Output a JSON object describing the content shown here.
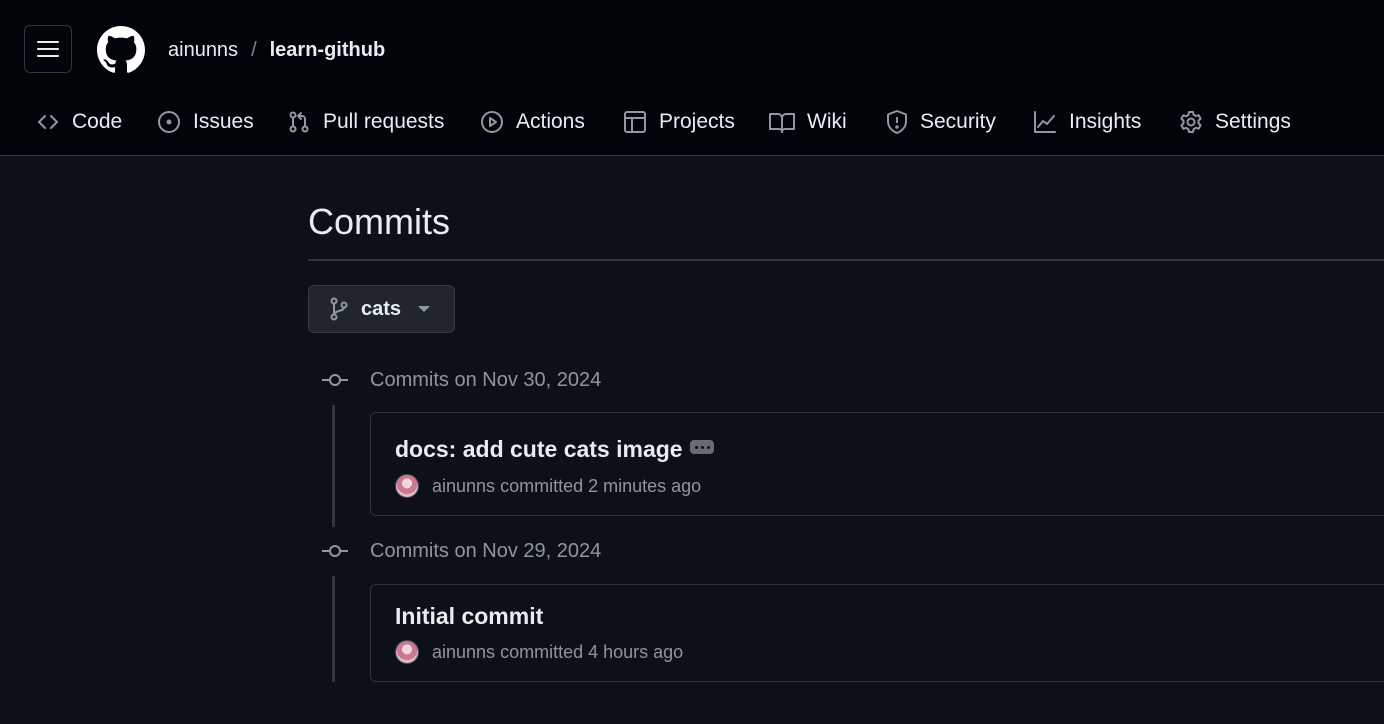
{
  "header": {
    "owner": "ainunns",
    "separator": "/",
    "repo": "learn-github"
  },
  "tabs": [
    {
      "label": "Code",
      "icon": "code-icon"
    },
    {
      "label": "Issues",
      "icon": "issue-opened-icon"
    },
    {
      "label": "Pull requests",
      "icon": "git-pull-request-icon"
    },
    {
      "label": "Actions",
      "icon": "play-icon"
    },
    {
      "label": "Projects",
      "icon": "table-icon"
    },
    {
      "label": "Wiki",
      "icon": "book-icon"
    },
    {
      "label": "Security",
      "icon": "shield-icon"
    },
    {
      "label": "Insights",
      "icon": "graph-icon"
    },
    {
      "label": "Settings",
      "icon": "gear-icon"
    }
  ],
  "page": {
    "title": "Commits",
    "branch": "cats"
  },
  "commit_groups": [
    {
      "date_label": "Commits on Nov 30, 2024",
      "commits": [
        {
          "message": "docs: add cute cats image",
          "author": "ainunns",
          "action": "committed",
          "time": "2 minutes ago"
        }
      ]
    },
    {
      "date_label": "Commits on Nov 29, 2024",
      "commits": [
        {
          "message": "Initial commit",
          "author": "ainunns",
          "action": "committed",
          "time": "4 hours ago"
        }
      ]
    }
  ],
  "colors": {
    "background": "#0d1117",
    "header_background": "#010409",
    "border": "#30363d",
    "muted_text": "#8d96a0",
    "text": "#e6edf3"
  }
}
